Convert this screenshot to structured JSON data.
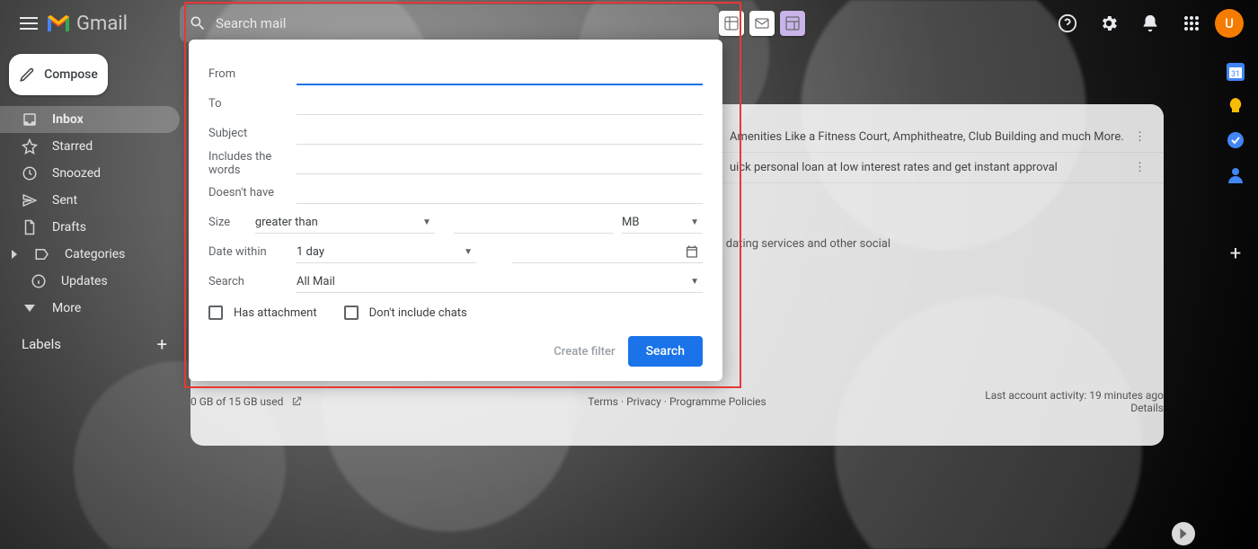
{
  "header": {
    "product": "Gmail",
    "search_placeholder": "Search mail",
    "avatar_initial": "U"
  },
  "compose_label": "Compose",
  "nav": {
    "inbox": "Inbox",
    "starred": "Starred",
    "snoozed": "Snoozed",
    "sent": "Sent",
    "drafts": "Drafts",
    "categories": "Categories",
    "updates": "Updates",
    "more": "More"
  },
  "labels_header": "Labels",
  "advanced_search": {
    "from": "From",
    "to": "To",
    "subject": "Subject",
    "includes": "Includes the words",
    "doesnt": "Doesn't have",
    "size": "Size",
    "size_op": "greater than",
    "size_unit": "MB",
    "date_within": "Date within",
    "date_range": "1 day",
    "search_label": "Search",
    "search_in": "All Mail",
    "has_attachment": "Has attachment",
    "no_chats": "Don't include chats",
    "create_filter": "Create filter",
    "search_btn": "Search"
  },
  "mail": {
    "row1": "Amenities Like a Fitness Court, Amphitheatre, Club Building and much More.",
    "row2": "uick personal loan at low interest rates and get instant approval",
    "social_text": ", dating services and other social"
  },
  "footer": {
    "storage": "0 GB of 15 GB used",
    "terms": "Terms",
    "privacy": "Privacy",
    "policies": "Programme Policies",
    "activity": "Last account activity: 19 minutes ago",
    "details": "Details"
  }
}
